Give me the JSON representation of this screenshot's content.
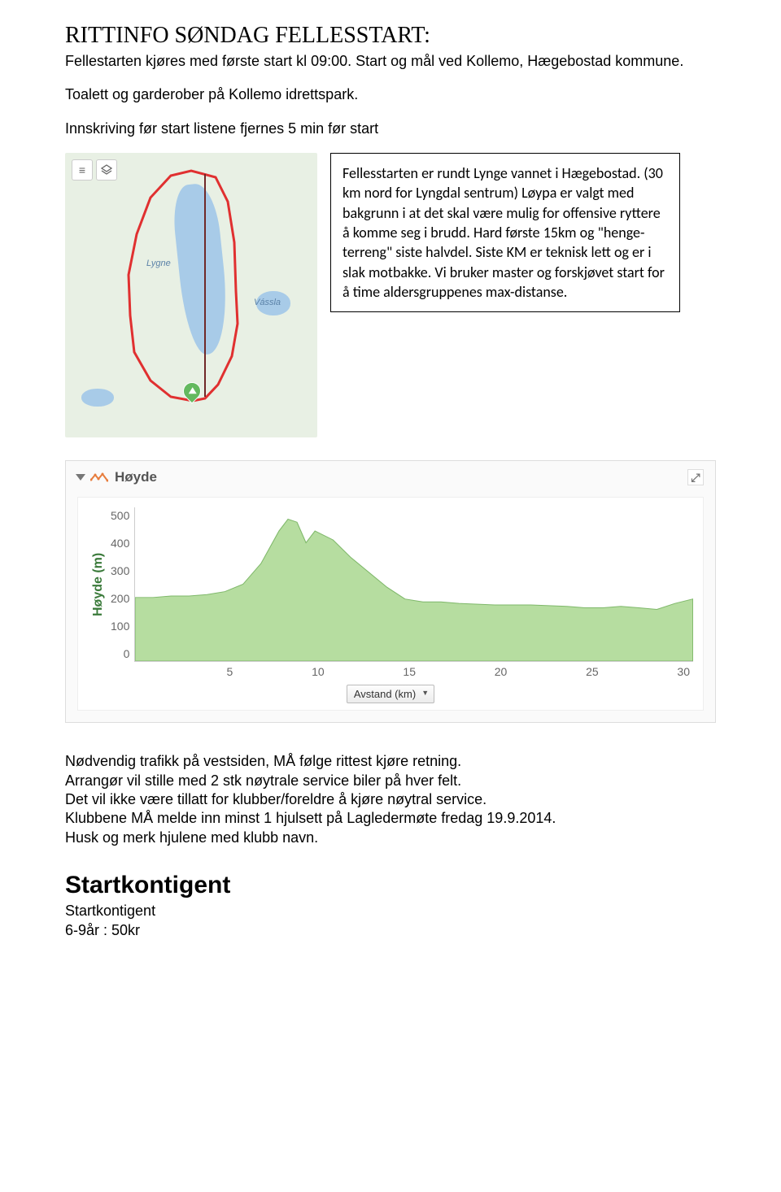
{
  "title": "RITTINFO SØNDAG FELLESSTART:",
  "intro1": "Fellestarten kjøres med første start kl 09:00. Start og mål ved Kollemo, Hægebostad kommune.",
  "intro2": "Toalett og garderober på Kollemo idrettspark.",
  "intro3": "Innskriving før start listene fjernes 5 min før start",
  "map": {
    "lake_label_main": "Lygne",
    "lake_label_small": "Vássla",
    "layers_icon": "layers-icon",
    "menu_icon": "menu-icon"
  },
  "description_box": "Fellesstarten er rundt Lynge vannet i Hægebostad. (30 km nord for Lyngdal sentrum) Løypa er valgt med bakgrunn i at det skal være mulig for offensive ryttere å komme seg i brudd. Hard første 15km og \"henge-terreng\" siste halvdel. Siste KM er teknisk lett og er i slak motbakke. Vi bruker master og forskjøvet start for å time aldersgruppenes max-distanse.",
  "elev": {
    "header": "Høyde",
    "ylabel": "Høyde (m)",
    "xlabel": "Avstand (km)",
    "yticks": [
      "500",
      "400",
      "300",
      "200",
      "100",
      "0"
    ],
    "xticks": [
      "5",
      "10",
      "15",
      "20",
      "25",
      "30"
    ]
  },
  "chart_data": {
    "type": "area",
    "title": "Høyde",
    "xlabel": "Avstand (km)",
    "ylabel": "Høyde (m)",
    "xlim": [
      0,
      31
    ],
    "ylim": [
      0,
      520
    ],
    "x": [
      0,
      1,
      2,
      3,
      4,
      5,
      6,
      7,
      8,
      8.5,
      9,
      9.5,
      10,
      11,
      12,
      13,
      14,
      15,
      16,
      17,
      18,
      20,
      22,
      24,
      25,
      26,
      27,
      28,
      29,
      30,
      31
    ],
    "values": [
      215,
      215,
      220,
      220,
      225,
      235,
      260,
      330,
      440,
      480,
      470,
      400,
      440,
      410,
      350,
      300,
      250,
      210,
      200,
      200,
      195,
      190,
      190,
      185,
      180,
      180,
      185,
      180,
      175,
      195,
      210
    ]
  },
  "bottom": {
    "l1": "Nødvendig trafikk på vestsiden, MÅ følge rittest kjøre retning.",
    "l2": " Arrangør vil stille med 2 stk nøytrale service biler på hver felt.",
    "l3": "Det vil ikke være tillatt for klubber/foreldre å kjøre nøytral service.",
    "l4": "Klubbene MÅ melde inn minst 1 hjulsett på Lagledermøte fredag 19.9.2014.",
    "l5": "Husk og merk hjulene med klubb navn."
  },
  "fee": {
    "heading": "Startkontigent",
    "line1": "Startkontigent",
    "line2": "6-9år : 50kr"
  }
}
